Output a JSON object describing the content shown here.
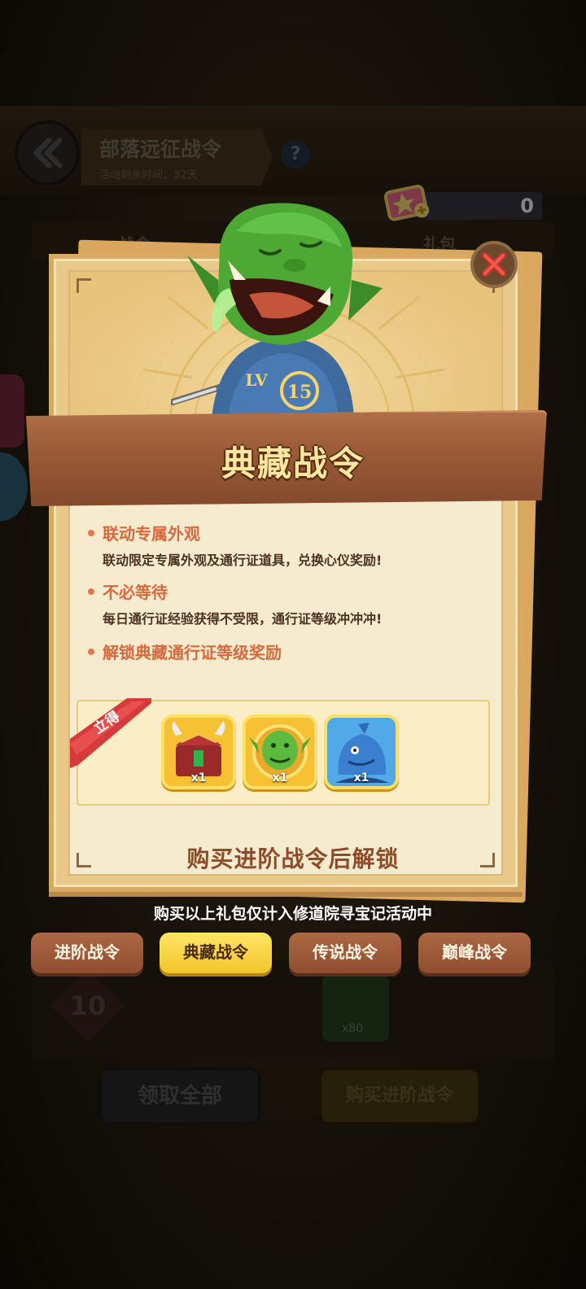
{
  "background": {
    "title": "部落远征战令",
    "subtitle": "活动剩余时间：32天",
    "help_label": "?",
    "currency_count": "0",
    "tabs": [
      "战令",
      "礼包"
    ],
    "level_badge": "10",
    "moon_reward_count": "x80",
    "claim_all_label": "领取全部",
    "buy_pass_label": "购买进阶战令"
  },
  "popup": {
    "title": "典藏战令",
    "features": [
      {
        "head": "联动专属外观",
        "desc": "联动限定专属外观及通行证道具，兑换心仪奖励!"
      },
      {
        "head": "不必等待",
        "desc": "每日通行证经验获得不受限，通行证等级冲冲冲!"
      },
      {
        "head": "解锁典藏通行证等级奖励",
        "desc": ""
      }
    ],
    "instant_label": "立得",
    "rewards": [
      {
        "icon": "treasure-chest-icon",
        "count": "x1"
      },
      {
        "icon": "goblin-medal-icon",
        "count": "x1"
      },
      {
        "icon": "blue-fish-hero-icon",
        "count": "x1"
      }
    ],
    "unlock_text": "购买进阶战令后解锁",
    "goblin_shirt": "LV",
    "goblin_badge": "15"
  },
  "notice": "购买以上礼包仅计入修道院寻宝记活动中",
  "tiers": [
    {
      "label": "进阶战令",
      "active": false
    },
    {
      "label": "典藏战令",
      "active": true
    },
    {
      "label": "传说战令",
      "active": false
    },
    {
      "label": "巅峰战令",
      "active": false
    }
  ],
  "colors": {
    "accent_orange": "#d8683e",
    "active_tab": "#f3c52b",
    "inactive_tab": "#9a5a37",
    "panel_bg": "#f7ebcf"
  }
}
